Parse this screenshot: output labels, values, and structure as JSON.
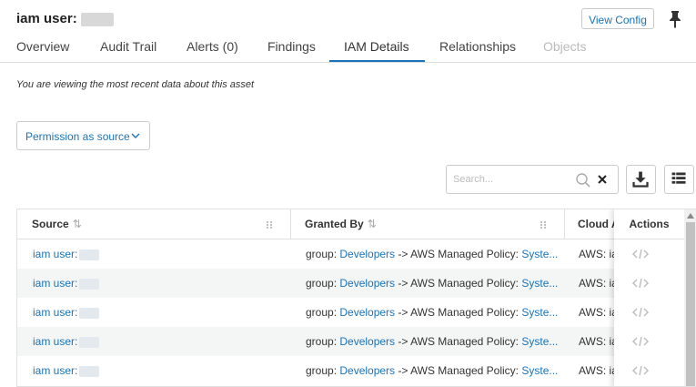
{
  "header": {
    "title": "iam user:",
    "view_config_label": "View Config",
    "pin_icon": "pin-icon"
  },
  "tabs": [
    {
      "label": "Overview",
      "state": "normal"
    },
    {
      "label": "Audit Trail",
      "state": "normal"
    },
    {
      "label": "Alerts (0)",
      "state": "normal"
    },
    {
      "label": "Findings",
      "state": "normal"
    },
    {
      "label": "IAM Details",
      "state": "active"
    },
    {
      "label": "Relationships",
      "state": "normal"
    },
    {
      "label": "Objects",
      "state": "disabled"
    }
  ],
  "notice": "You are viewing the most recent data about this asset",
  "permission_dropdown": {
    "selected": "Permission as source"
  },
  "search": {
    "placeholder": "Search..."
  },
  "toolbar": {
    "download_icon": "download-icon",
    "columns_icon": "columns-icon"
  },
  "table": {
    "columns": [
      {
        "label": "Source"
      },
      {
        "label": "Granted By"
      },
      {
        "label": "Cloud A"
      },
      {
        "label": "Actions"
      }
    ],
    "rows": [
      {
        "source": "iam user:",
        "granted_prefix": "group: ",
        "group": "Developers",
        "arrow": " -> AWS Managed Policy: ",
        "policy": "Syste...",
        "cloud": "AWS: ia"
      },
      {
        "source": "iam user:",
        "granted_prefix": "group: ",
        "group": "Developers",
        "arrow": " -> AWS Managed Policy: ",
        "policy": "Syste...",
        "cloud": "AWS: ia"
      },
      {
        "source": "iam user:",
        "granted_prefix": "group: ",
        "group": "Developers",
        "arrow": " -> AWS Managed Policy: ",
        "policy": "Syste...",
        "cloud": "AWS: ia"
      },
      {
        "source": "iam user:",
        "granted_prefix": "group: ",
        "group": "Developers",
        "arrow": " -> AWS Managed Policy: ",
        "policy": "Syste...",
        "cloud": "AWS: ia"
      },
      {
        "source": "iam user:",
        "granted_prefix": "group: ",
        "group": "Developers",
        "arrow": " -> AWS Managed Policy: ",
        "policy": "Syste...",
        "cloud": "AWS: ia"
      }
    ]
  },
  "colors": {
    "accent": "#1a73b8",
    "row_alt": "#f4f5f5"
  }
}
